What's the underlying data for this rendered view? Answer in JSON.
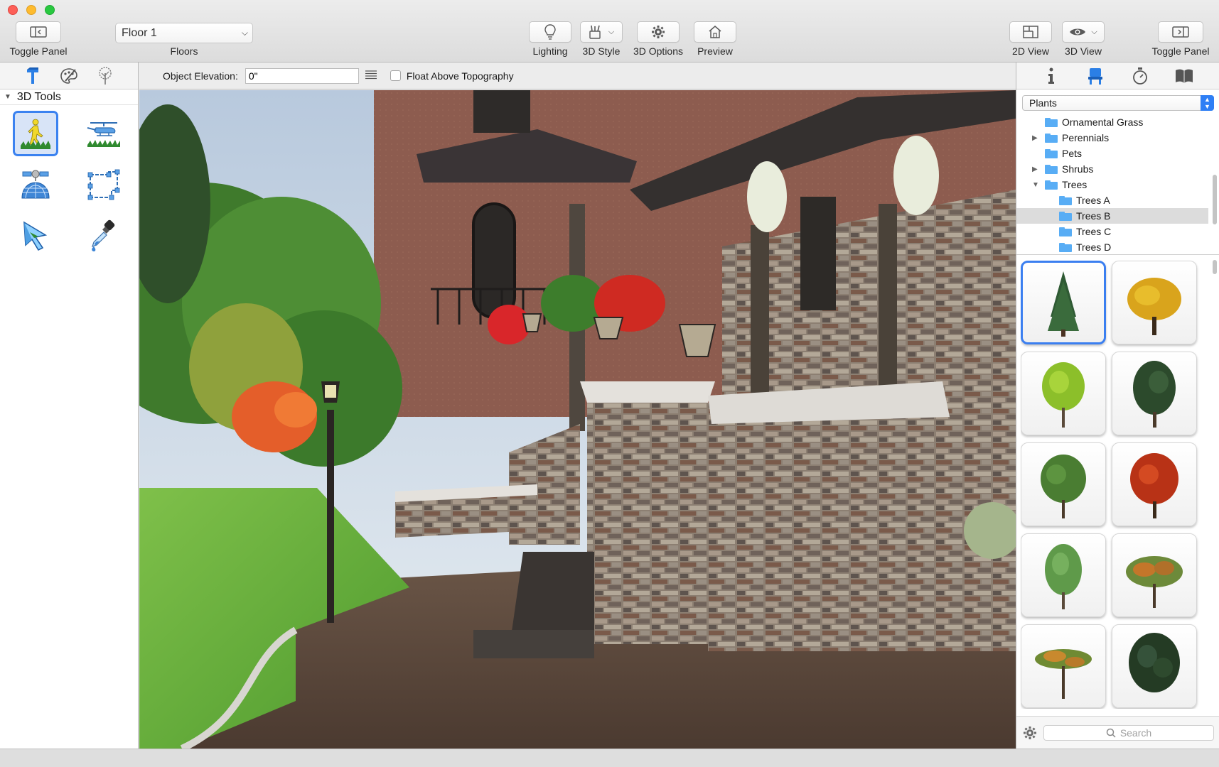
{
  "window": {
    "colors": {
      "close": "#fd5f57",
      "minimize": "#febb2e",
      "maximize": "#29c840",
      "accent": "#3b82f0"
    }
  },
  "toolbar": {
    "toggle_left": "Toggle Panel",
    "floor_value": "Floor 1",
    "floors_label": "Floors",
    "lighting": "Lighting",
    "style_3d": "3D Style",
    "options_3d": "3D Options",
    "preview": "Preview",
    "view_2d": "2D View",
    "view_3d": "3D View",
    "toggle_right": "Toggle Panel"
  },
  "left_panel": {
    "tabs": [
      "hammer-icon",
      "palette-brush-icon",
      "tree-icon"
    ],
    "section_title": "3D Tools",
    "tools": [
      "walk-icon",
      "helicopter-icon",
      "satellite-icon",
      "room-frame-icon",
      "arrow-select-icon",
      "eyedropper-icon"
    ]
  },
  "options_bar": {
    "elevation_label": "Object Elevation:",
    "elevation_value": "0\"",
    "float_label": "Float Above Topography"
  },
  "right_panel": {
    "tabs": [
      "info-icon",
      "chair-icon",
      "stopwatch-icon",
      "book-icon"
    ],
    "category": "Plants",
    "tree_items": [
      {
        "label": "Ornamental Grass",
        "level": 0,
        "expander": ""
      },
      {
        "label": "Perennials",
        "level": 0,
        "expander": "▶"
      },
      {
        "label": "Pets",
        "level": 0,
        "expander": ""
      },
      {
        "label": "Shrubs",
        "level": 0,
        "expander": "▶"
      },
      {
        "label": "Trees",
        "level": 0,
        "expander": "▼"
      },
      {
        "label": "Trees A",
        "level": 1,
        "expander": ""
      },
      {
        "label": "Trees B",
        "level": 1,
        "expander": "",
        "selected": true
      },
      {
        "label": "Trees C",
        "level": 1,
        "expander": ""
      },
      {
        "label": "Trees D",
        "level": 1,
        "expander": ""
      }
    ],
    "thumbnails": [
      "spruce-tree",
      "yellow-autumn-tree",
      "lime-green-tree",
      "dark-green-tree",
      "green-tree",
      "red-maple-tree",
      "light-green-tree",
      "spreading-orange-tree",
      "flat-top-tree",
      "dark-leafy-tree"
    ],
    "search_placeholder": "Search"
  }
}
